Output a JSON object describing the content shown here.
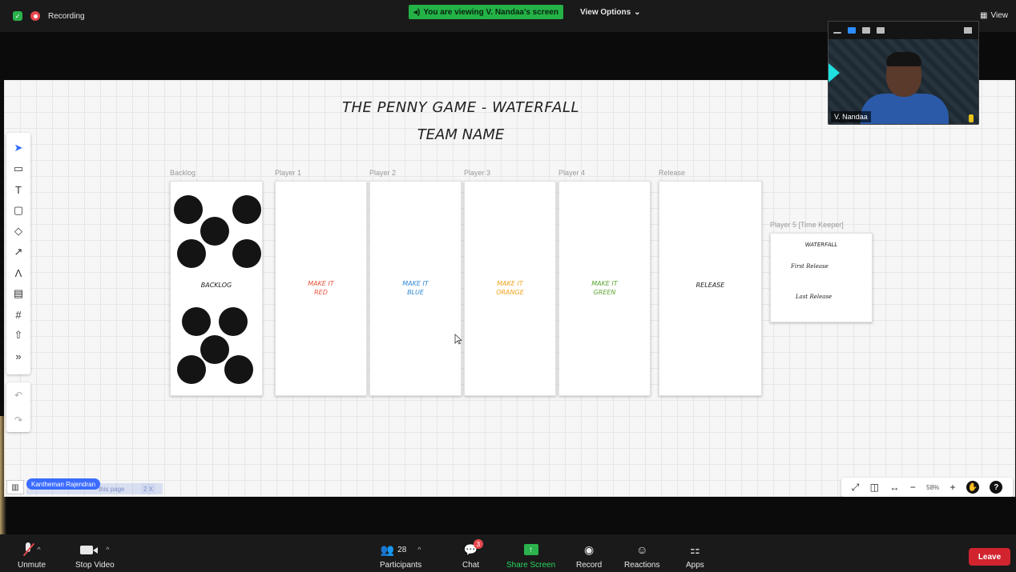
{
  "top_bar": {
    "recording_label": "Recording",
    "viewing_banner": "You are viewing V. Nandaa's screen",
    "view_options_label": "View Options",
    "view_label": "View"
  },
  "video_tile": {
    "participant_name": "V. Nandaa"
  },
  "board": {
    "title_line1": "THE PENNY GAME - WATERFALL",
    "title_line2": "TEAM NAME",
    "columns": [
      {
        "label": "Backlog",
        "card_text": "BACKLOG",
        "color": "#222222"
      },
      {
        "label": "Player 1",
        "card_text_1": "MAKE IT",
        "card_text_2": "RED",
        "color": "#e8523a"
      },
      {
        "label": "Player 2",
        "card_text_1": "MAKE IT",
        "card_text_2": "BLUE",
        "color": "#2d86d4"
      },
      {
        "label": "Player 3",
        "card_text_1": "MAKE IT",
        "card_text_2": "ORANGE",
        "color": "#f2a31b"
      },
      {
        "label": "Player 4",
        "card_text_1": "MAKE IT",
        "card_text_2": "GREEN",
        "color": "#5aa62f"
      },
      {
        "label": "Release",
        "card_text": "RELEASE",
        "color": "#222222"
      }
    ],
    "player5": {
      "label": "Player 5 [Time Keeper]",
      "title": "WATERFALL",
      "line1": "First Release",
      "line2": "Last Release"
    },
    "presenter_chip": "Kantheman Rajendran",
    "ghost_text": "this page",
    "ghost_page": "2 X",
    "zoom_percent": "58%"
  },
  "icons": {
    "toolbar": [
      "select-icon",
      "frame-icon",
      "text-icon",
      "sticky-note-icon",
      "shapes-icon",
      "arrow-icon",
      "pen-icon",
      "comment-icon",
      "crop-icon",
      "upload-icon",
      "more-icon"
    ]
  },
  "bottom_bar": {
    "unmute_label": "Unmute",
    "stop_video_label": "Stop Video",
    "participants_label": "Participants",
    "participants_count": "28",
    "chat_label": "Chat",
    "chat_badge": "3",
    "share_label": "Share Screen",
    "record_label": "Record",
    "reactions_label": "Reactions",
    "apps_label": "Apps",
    "leave_label": "Leave"
  },
  "colors": {
    "share_green": "#2bd65e",
    "leave_red": "#d1242f",
    "viewing_green": "#24b247"
  }
}
